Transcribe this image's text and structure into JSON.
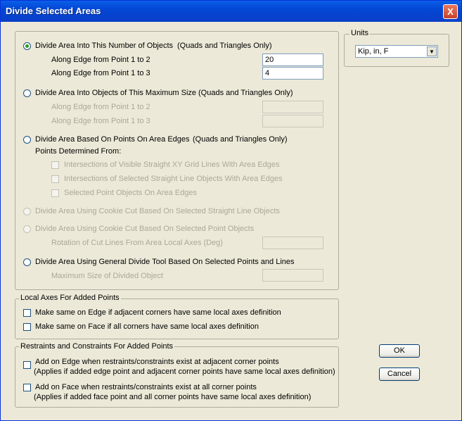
{
  "window": {
    "title": "Divide Selected Areas",
    "close_glyph": "X"
  },
  "divide": {
    "opt1_label": "Divide Area Into This Number of Objects",
    "opt1_note": "(Quads and Triangles Only)",
    "edge12_label": "Along Edge from Point 1 to 2",
    "edge12_value": "20",
    "edge13_label": "Along Edge from Point 1 to 3",
    "edge13_value": "4",
    "opt2_label": "Divide Area Into Objects of This Maximum Size",
    "opt2_note": "(Quads and Triangles Only)",
    "opt2_edge12_label": "Along Edge from Point 1 to 2",
    "opt2_edge13_label": "Along Edge from Point 1 to 3",
    "opt3_label": "Divide Area Based On Points On Area Edges",
    "opt3_note": "(Quads and Triangles Only)",
    "points_from_label": "Points Determined From:",
    "points_opt1": "Intersections of Visible Straight XY Grid Lines With Area Edges",
    "points_opt2": "Intersections of Selected Straight Line Objects With Area Edges",
    "points_opt3": "Selected Point Objects On Area Edges",
    "opt4_label": "Divide Area Using Cookie Cut Based On Selected Straight Line Objects",
    "opt5_label": "Divide Area Using Cookie Cut Based On Selected Point Objects",
    "rotation_label": "Rotation of Cut Lines From Area Local Axes (Deg)",
    "opt6_label": "Divide Area Using General Divide Tool Based On Selected Points and Lines",
    "max_size_label": "Maximum Size of Divided Object"
  },
  "units": {
    "legend": "Units",
    "selected": "Kip, in, F"
  },
  "local_axes": {
    "legend": "Local Axes For Added Points",
    "edge_label": "Make same on Edge if adjacent corners have same local axes definition",
    "face_label": "Make same on Face if all corners have same local axes definition"
  },
  "restraints": {
    "legend": "Restraints and Constraints For Added Points",
    "edge_label": "Add on Edge when restraints/constraints exist at adjacent corner points",
    "edge_note": "(Applies if added edge point and adjacent corner points have same local axes definition)",
    "face_label": "Add on Face when restraints/constraints exist at all corner points",
    "face_note": "(Applies if added face point and all corner points have same local axes definition)"
  },
  "buttons": {
    "ok": "OK",
    "cancel": "Cancel"
  }
}
